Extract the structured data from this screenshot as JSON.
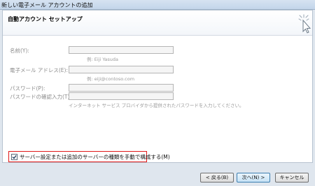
{
  "window": {
    "title": "新しい電子メール アカウントの追加"
  },
  "header": {
    "heading": "自動アカウント セットアップ"
  },
  "form": {
    "name_label": "名前(Y):",
    "name_value": "",
    "name_example": "例: Eiji Yasuda",
    "email_label": "電子メール アドレス(E):",
    "email_value": "",
    "email_example": "例: eiji@contoso.com",
    "password_label": "パスワード(P):",
    "password_confirm_label": "パスワードの確認入力(T):",
    "password_hint": "インターネット サービス プロバイダから提供されたパスワードを入力してください。"
  },
  "manual_setup": {
    "label": "サーバー設定または追加のサーバーの種類を手動で構成する(M)",
    "checked": true
  },
  "buttons": {
    "back": "< 戻る(B)",
    "next": "次へ(N) >",
    "cancel": "キャンセル"
  },
  "icons": {
    "header_icon": "cursor-click-icon",
    "check_icon": "checkmark-icon"
  },
  "colors": {
    "highlight": "#e01818",
    "primary_border": "#3c7fb1"
  }
}
